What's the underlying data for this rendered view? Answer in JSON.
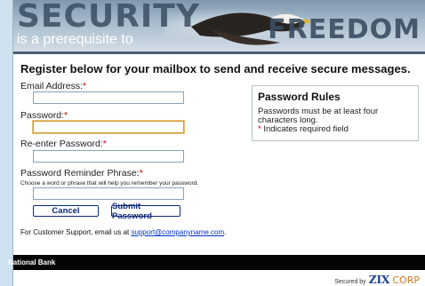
{
  "banner": {
    "line1": "SECURITY",
    "line2": "is a prerequisite to",
    "line3": "FREEDOM"
  },
  "form": {
    "heading": "Register below for your mailbox to send and receive secure messages.",
    "email_label": "Email Address:",
    "email_value": "",
    "password_label": "Password:",
    "password_value": "",
    "reenter_label": "Re-enter Password:",
    "reenter_value": "",
    "reminder_label": "Password Reminder Phrase:",
    "reminder_hint": "Choose a word or phrase that will help you remember your password.",
    "reminder_value": "",
    "required_marker": "*",
    "cancel_label": "Cancel",
    "submit_label": "Submit Password",
    "support_prefix": "For Customer Support, email us at ",
    "support_email": "support@companyname.com",
    "support_suffix": "."
  },
  "rules": {
    "title": "Password Rules",
    "text": "Passwords must be at least four characters long.",
    "required_note": " Indicates required field"
  },
  "footer": {
    "bank_name": "National Bank",
    "secured_by": "Secured by",
    "brand_zix": "ZIX",
    "brand_corp": "CORP"
  },
  "colors": {
    "accent": "#0c2a7a",
    "required": "#cc0000",
    "focus_border": "#d49a36",
    "footer_bg": "#050505"
  }
}
